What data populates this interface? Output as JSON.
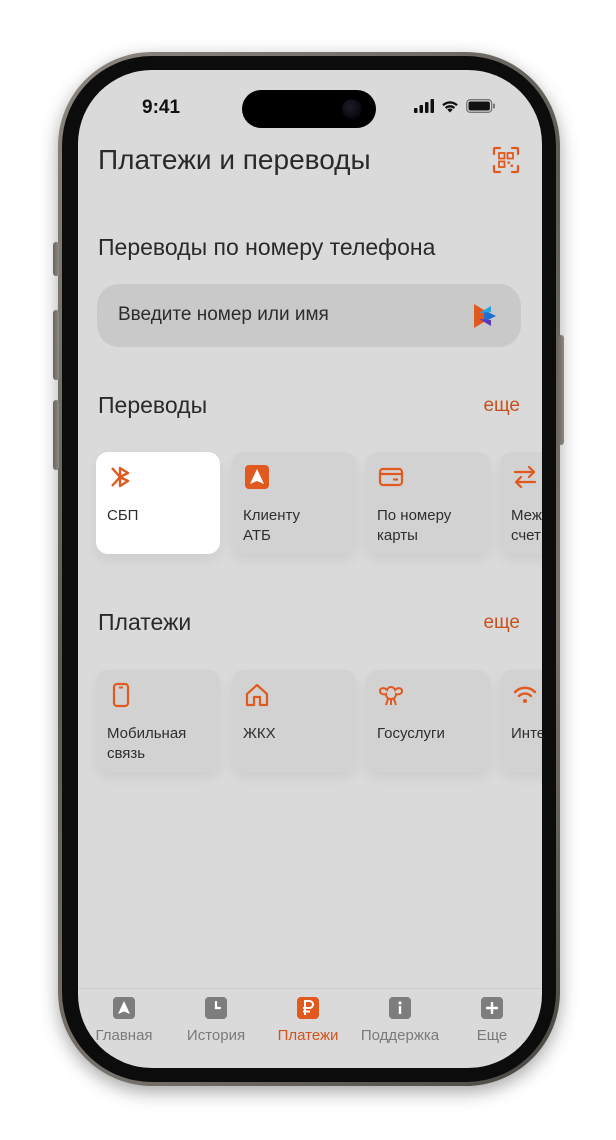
{
  "status": {
    "time": "9:41"
  },
  "header": {
    "title": "Платежи и переводы",
    "qr_icon": "qr-scan-icon"
  },
  "phone_transfers": {
    "title": "Переводы по номеру телефона",
    "placeholder": "Введите номер или имя",
    "icon": "sbp-logo-icon"
  },
  "transfers": {
    "title": "Переводы",
    "more": "еще",
    "items": [
      {
        "label": "СБП",
        "icon": "sbp-icon"
      },
      {
        "label": "Клиенту\nАТБ",
        "icon": "atb-icon"
      },
      {
        "label": "По номеру\nкарты",
        "icon": "card-icon"
      },
      {
        "label": "Меж\nсчет",
        "icon": "swap-arrows-icon"
      }
    ]
  },
  "payments": {
    "title": "Платежи",
    "more": "еще",
    "items": [
      {
        "label": "Мобильная\nсвязь",
        "icon": "mobile-icon"
      },
      {
        "label": "ЖКХ",
        "icon": "house-icon"
      },
      {
        "label": "Госуслуги",
        "icon": "gosuslugi-eagle-icon"
      },
      {
        "label": "Инте",
        "icon": "wifi-icon"
      }
    ]
  },
  "tabbar": {
    "items": [
      {
        "label": "Главная",
        "icon": "home-icon",
        "active": false
      },
      {
        "label": "История",
        "icon": "history-icon",
        "active": false
      },
      {
        "label": "Платежи",
        "icon": "ruble-icon",
        "active": true
      },
      {
        "label": "Поддержка",
        "icon": "info-icon",
        "active": false
      },
      {
        "label": "Еще",
        "icon": "plus-icon",
        "active": false
      }
    ]
  },
  "colors": {
    "accent": "#e05a1f",
    "screen_bg": "#dadada"
  }
}
